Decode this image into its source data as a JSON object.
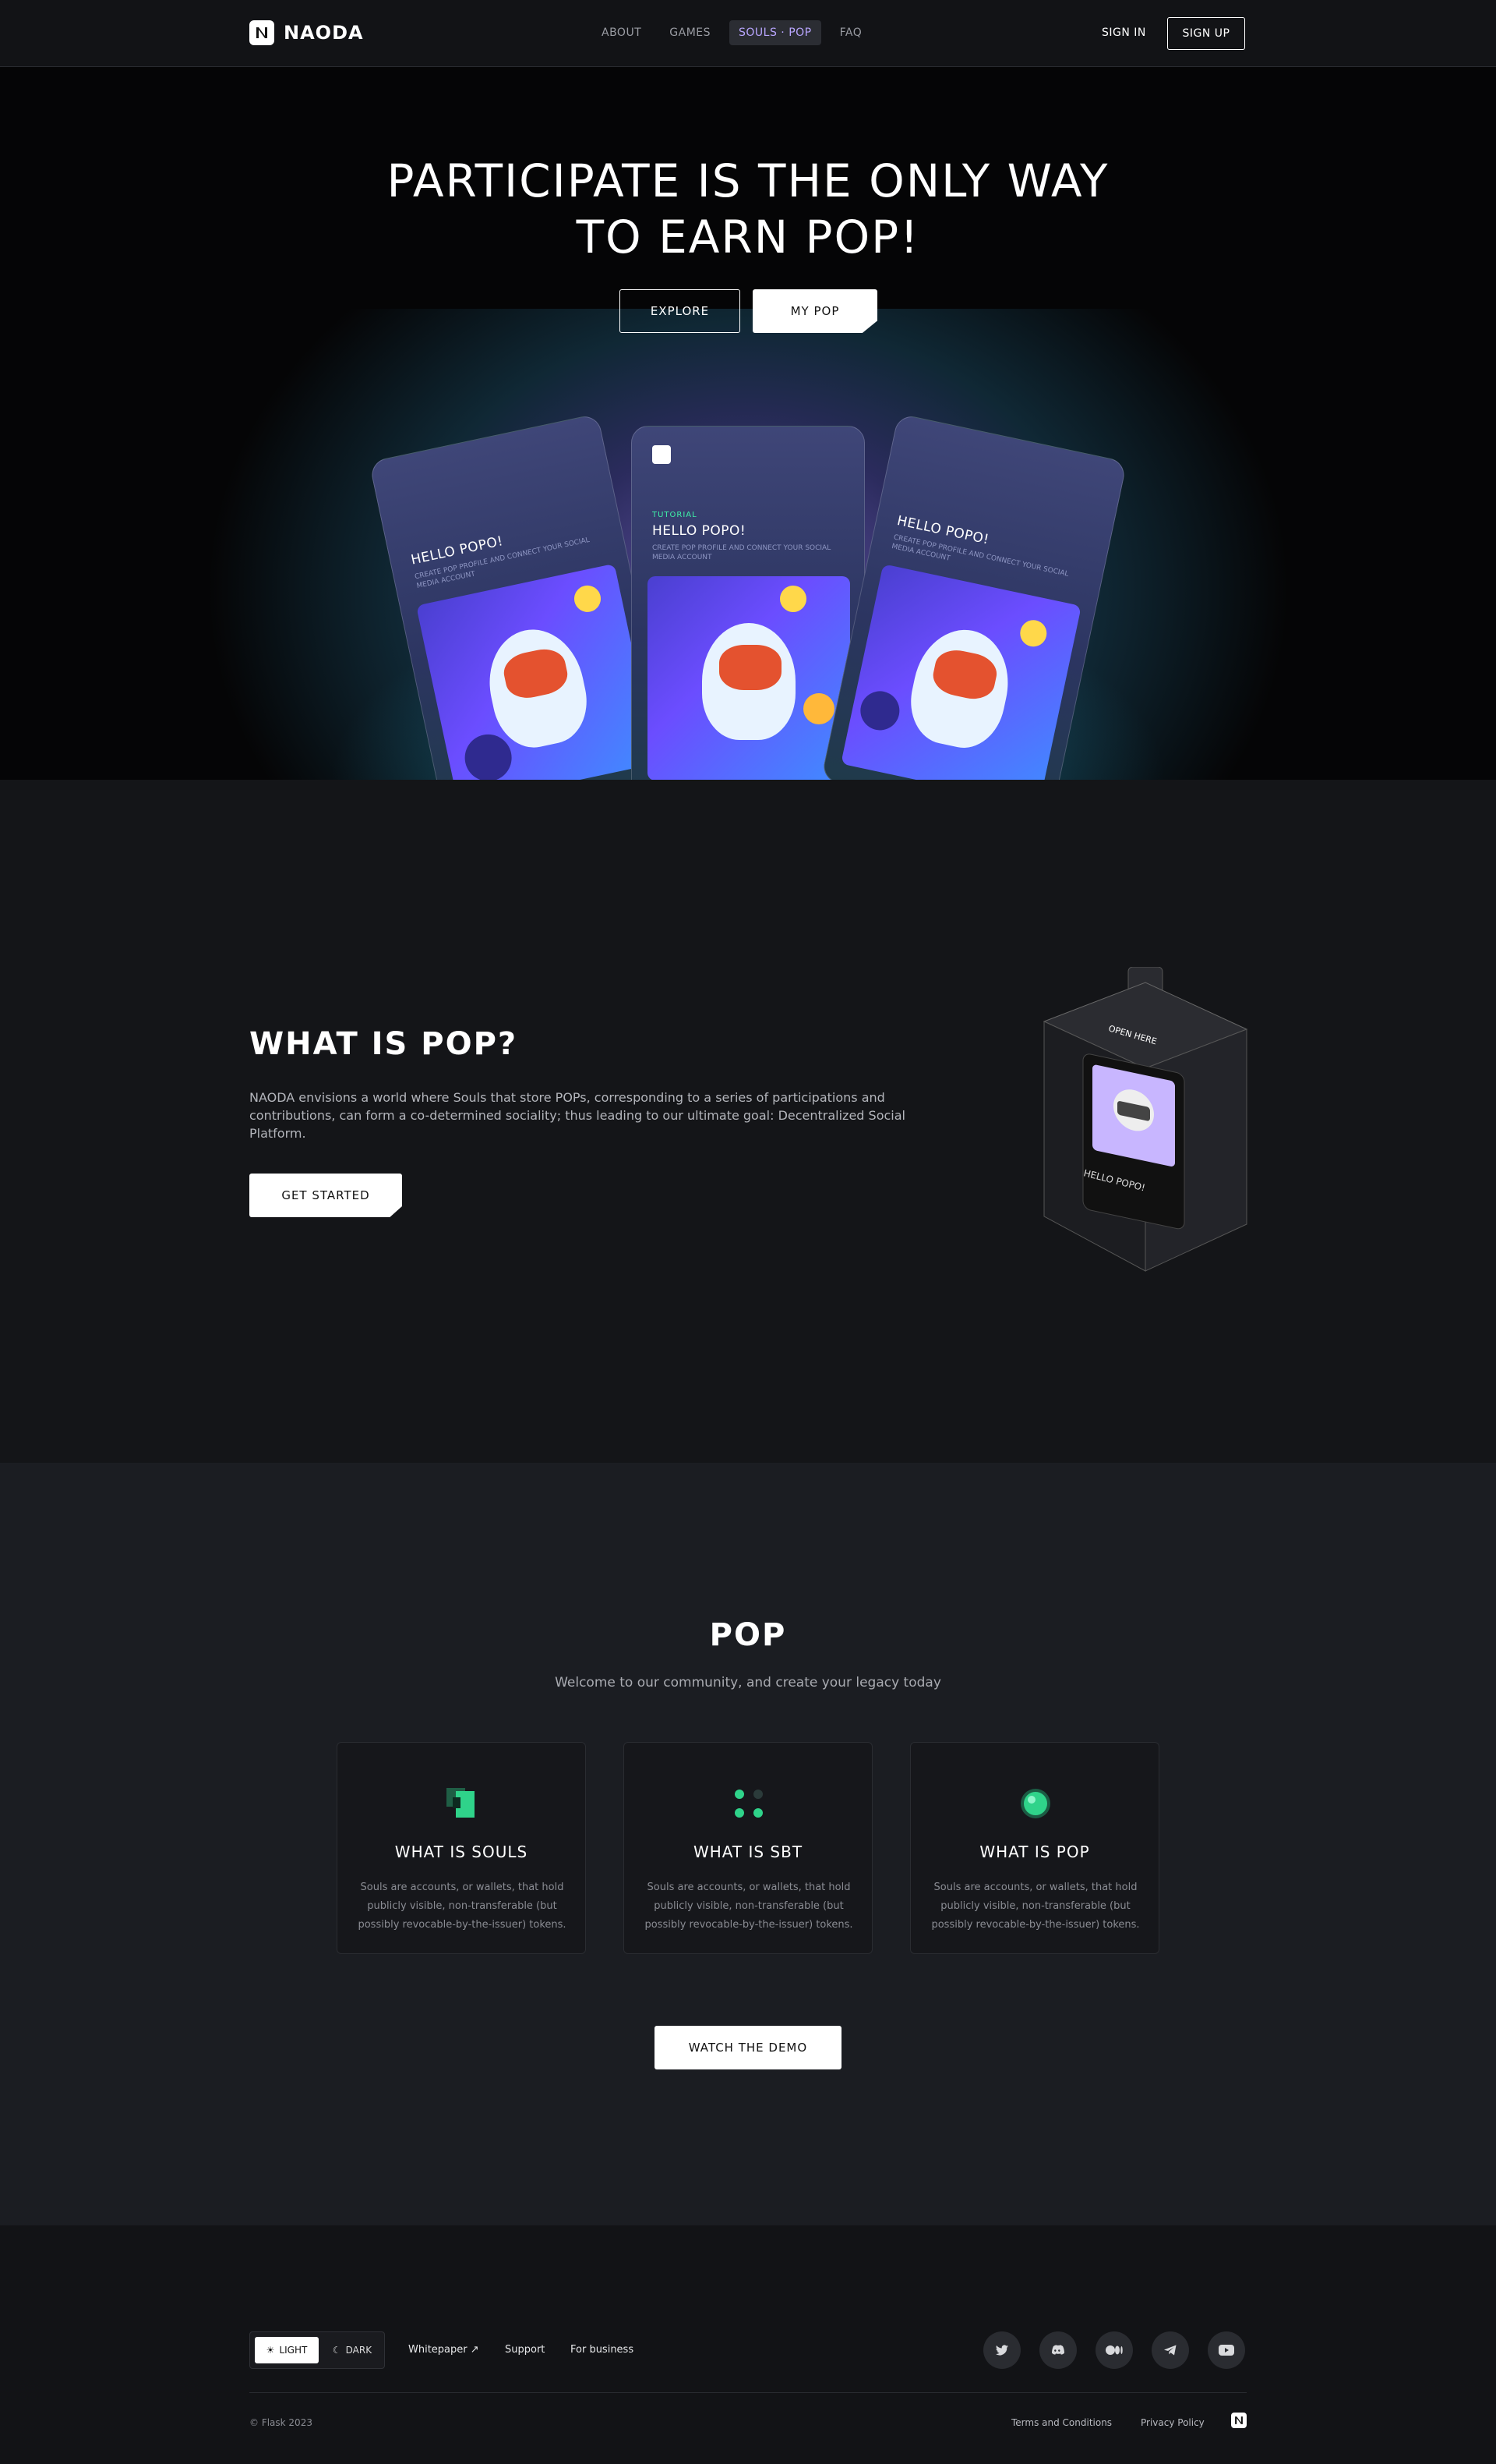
{
  "brand": {
    "name": "NAODA"
  },
  "nav": {
    "links": [
      {
        "label": "ABOUT"
      },
      {
        "label": "GAMES"
      },
      {
        "label": "SOULS · POP"
      },
      {
        "label": "FAQ"
      }
    ],
    "sign_in": "SIGN IN",
    "sign_up": "SIGN UP"
  },
  "hero": {
    "title_line1": "PARTICIPATE IS THE ONLY WAY",
    "title_line2": "TO EARN POP!",
    "explore": "EXPLORE",
    "my_pop": "MY POP",
    "cards": [
      {
        "title": "HELLO POPO!",
        "sub": "CREATE POP PROFILE AND CONNECT YOUR SOCIAL MEDIA ACCOUNT"
      },
      {
        "tag": "TUTORIAL",
        "title": "HELLO POPO!",
        "sub": "CREATE POP PROFILE AND CONNECT YOUR SOCIAL MEDIA ACCOUNT"
      },
      {
        "title": "HELLO POPO!",
        "sub": "CREATE POP PROFILE AND CONNECT YOUR SOCIAL MEDIA ACCOUNT"
      }
    ]
  },
  "what": {
    "title": "WHAT IS POP?",
    "text": "NAODA envisions a world where Souls that store POPs, corresponding to a series of participations and contributions, can form a co-determined sociality; thus leading to our ultimate goal: Decentralized Social Platform.",
    "cta": "GET STARTED",
    "box_label": "OPEN HERE",
    "box_card_title": "HELLO POPO!"
  },
  "pop": {
    "title": "POP",
    "subtitle": "Welcome to our community, and create your legacy today",
    "features": [
      {
        "title": "WHAT IS SOULS",
        "text": "Souls are accounts, or wallets, that hold publicly visible, non-transferable (but possibly revocable-by-the-issuer) tokens."
      },
      {
        "title": "WHAT IS SBT",
        "text": "Souls are accounts, or wallets, that hold publicly visible, non-transferable (but possibly revocable-by-the-issuer) tokens."
      },
      {
        "title": "WHAT IS POP",
        "text": "Souls are accounts, or wallets, that hold publicly visible, non-transferable (but possibly revocable-by-the-issuer) tokens."
      }
    ],
    "demo": "WATCH THE DEMO"
  },
  "footer": {
    "theme_light": "LIGHT",
    "theme_dark": "DARK",
    "links": [
      "Whitepaper",
      "Support",
      "For business"
    ],
    "socials": [
      "twitter-icon",
      "discord-icon",
      "medium-icon",
      "telegram-icon",
      "youtube-icon"
    ],
    "copyright": "© Flask 2023",
    "terms": "Terms and Conditions",
    "privacy": "Privacy Policy"
  },
  "colors": {
    "accent_green": "#3ff2a8",
    "accent_purple": "#b9a6ff",
    "bg": "#16181c"
  }
}
